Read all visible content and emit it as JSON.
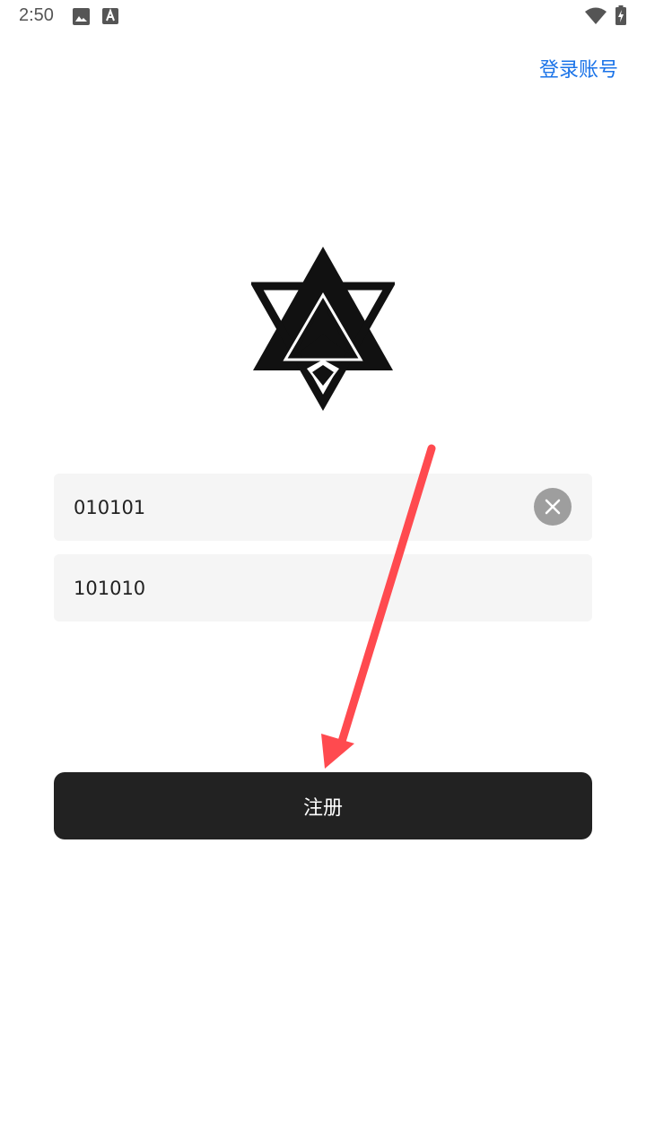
{
  "status_bar": {
    "time": "2:50",
    "icons": [
      "image-icon",
      "text-recognition-icon",
      "wifi-icon",
      "battery-charging-icon"
    ]
  },
  "header": {
    "login_link_label": "登录账号",
    "login_link_color": "#1a73e8"
  },
  "logo": {
    "icon": "star-triangle-logo-icon"
  },
  "form": {
    "username_value": "010101",
    "password_value": "101010",
    "clear_icon": "close-icon",
    "field_background": "#f5f5f5"
  },
  "register_button": {
    "label": "注册",
    "background": "#222222"
  },
  "annotation": {
    "arrow_color": "#ff4a4f"
  }
}
